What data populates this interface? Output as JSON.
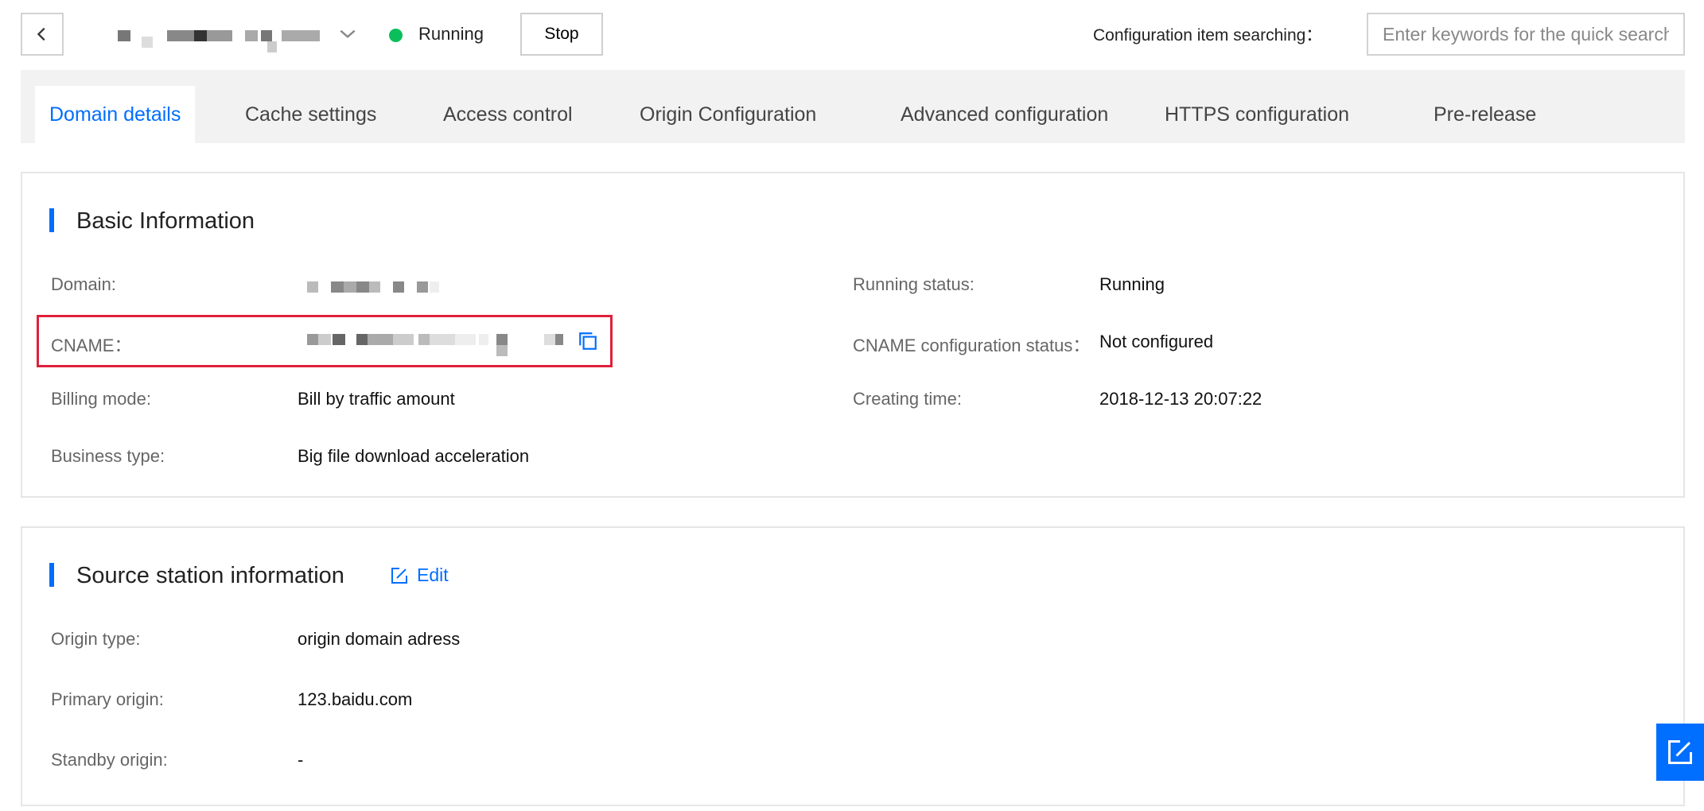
{
  "header": {
    "status": "Running",
    "stop_label": "Stop",
    "search_label": "Configuration item searching：",
    "search_placeholder": "Enter keywords for the quick search"
  },
  "tabs": [
    {
      "label": "Domain details",
      "active": true
    },
    {
      "label": "Cache settings",
      "active": false
    },
    {
      "label": "Access control",
      "active": false
    },
    {
      "label": "Origin Configuration",
      "active": false
    },
    {
      "label": "Advanced configuration",
      "active": false
    },
    {
      "label": "HTTPS configuration",
      "active": false
    },
    {
      "label": "Pre-release",
      "active": false
    }
  ],
  "basic": {
    "title": "Basic Information",
    "domain_label": "Domain:",
    "cname_label": "CNAME：",
    "billing_label": "Billing mode:",
    "billing_value": "Bill by traffic amount",
    "business_label": "Business type:",
    "business_value": "Big file download acceleration",
    "running_label": "Running status:",
    "running_value": "Running",
    "cname_status_label": "CNAME configuration status：",
    "cname_status_value": "Not configured",
    "creating_label": "Creating time:",
    "creating_value": "2018-12-13 20:07:22"
  },
  "source": {
    "title": "Source station information",
    "edit_label": "Edit",
    "origin_type_label": "Origin type:",
    "origin_type_value": "origin domain adress",
    "primary_label": "Primary origin:",
    "primary_value": "123.baidu.com",
    "standby_label": "Standby origin:",
    "standby_value": "-"
  },
  "colors": {
    "accent": "#006eff",
    "status_green": "#0abf5b",
    "highlight_red": "#e0203b"
  },
  "icons": [
    "back-icon",
    "chevron-down-icon",
    "copy-icon",
    "edit-icon",
    "feedback-icon"
  ]
}
